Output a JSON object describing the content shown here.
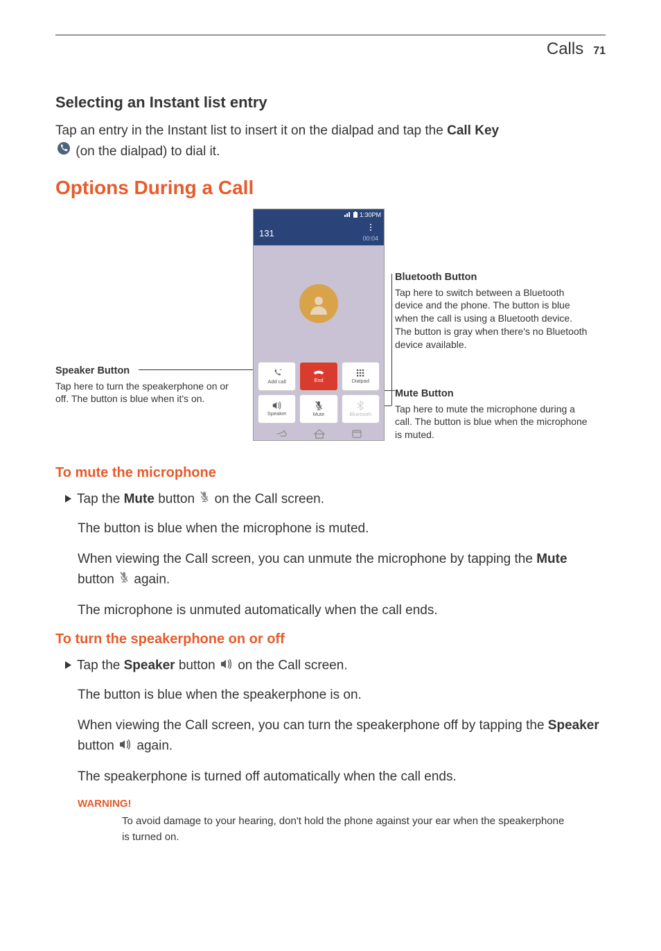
{
  "header": {
    "section": "Calls",
    "page": "71"
  },
  "s1": {
    "title": "Selecting an Instant list entry",
    "para_a": "Tap an entry in the Instant list to insert it on the dialpad and tap the ",
    "para_bold": "Call Key",
    "para_b": " (on the dialpad) to dial it."
  },
  "s2": {
    "title": "Options During a Call"
  },
  "phone": {
    "time": "1:30PM",
    "number": "131",
    "duration": "00:04",
    "btns": {
      "addcall": "Add call",
      "end": "End",
      "dialpad": "Dialpad",
      "speaker": "Speaker",
      "mute": "Mute",
      "bluetooth": "Bluetooth"
    }
  },
  "callouts": {
    "speaker": {
      "title": "Speaker Button",
      "body": "Tap here to turn the speakerphone on or off. The button is blue when it's on."
    },
    "bluetooth": {
      "title": "Bluetooth Button",
      "body": "Tap here to switch between a Bluetooth device and the phone. The button is blue when the call is using a Bluetooth device. The button is gray when there's no Bluetooth device available."
    },
    "mute": {
      "title": "Mute Button",
      "body": "Tap here to mute the microphone during a call. The button is blue when the microphone is muted."
    }
  },
  "s3": {
    "title": "To mute the microphone",
    "b1a": "Tap the ",
    "b1bold": "Mute",
    "b1b": " button ",
    "b1c": " on the Call screen.",
    "p1": "The button is blue when the microphone is muted.",
    "p2a": "When viewing the Call screen, you can unmute the microphone by tapping the ",
    "p2bold": "Mute",
    "p2b": " button ",
    "p2c": " again.",
    "p3": "The microphone is unmuted automatically when the call ends."
  },
  "s4": {
    "title": "To turn the speakerphone on or off",
    "b1a": "Tap the ",
    "b1bold": "Speaker",
    "b1b": " button ",
    "b1c": " on the Call screen.",
    "p1": "The button is blue when the speakerphone is on.",
    "p2a": "When viewing the Call screen, you can turn the speakerphone off by tapping the ",
    "p2bold": "Speaker",
    "p2b": " button ",
    "p2c": " again.",
    "p3": "The speakerphone is turned off automatically when the call ends."
  },
  "warning": {
    "label": "WARNING!",
    "text": "To avoid damage to your hearing, don't hold the phone against your ear when the speakerphone is turned on."
  }
}
